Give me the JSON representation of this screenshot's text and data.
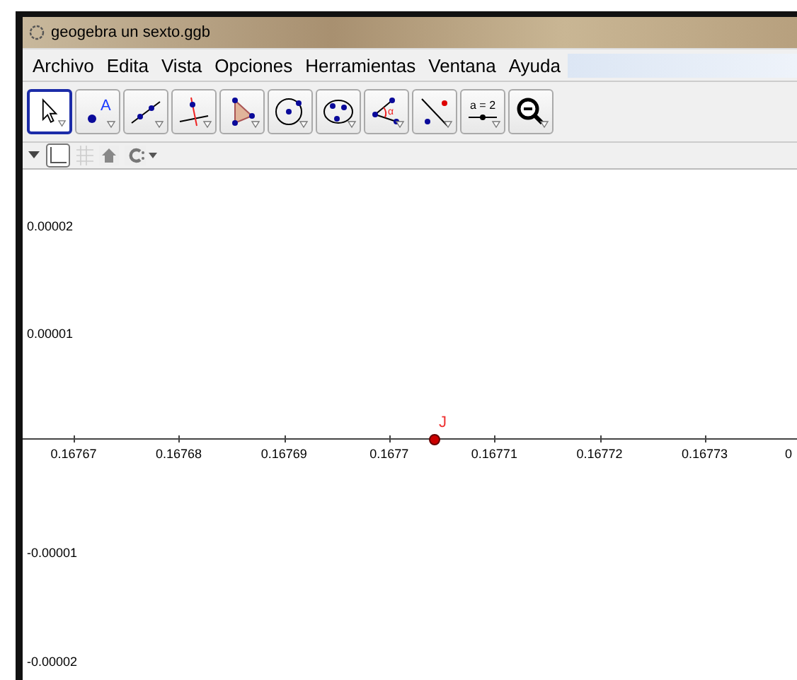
{
  "window": {
    "title": "geogebra un sexto.ggb"
  },
  "menu": [
    "Archivo",
    "Edita",
    "Vista",
    "Opciones",
    "Herramientas",
    "Ventana",
    "Ayuda"
  ],
  "tools": [
    {
      "kind": "move",
      "selected": true
    },
    {
      "kind": "point",
      "selected": false
    },
    {
      "kind": "line",
      "selected": false
    },
    {
      "kind": "perpendicular",
      "selected": false
    },
    {
      "kind": "polygon",
      "selected": false
    },
    {
      "kind": "circle",
      "selected": false
    },
    {
      "kind": "conic",
      "selected": false
    },
    {
      "kind": "angle",
      "selected": false
    },
    {
      "kind": "reflect",
      "selected": false
    },
    {
      "kind": "slider",
      "selected": false
    },
    {
      "kind": "zoom",
      "selected": false
    }
  ],
  "slider_label": "a = 2",
  "angle_label": "α",
  "point_tool_label": "A",
  "graph": {
    "y_labels": [
      "0.00002",
      "0.00001",
      "-0.00001",
      "-0.00002"
    ],
    "x_labels": [
      "0.16767",
      "0.16768",
      "0.16769",
      "0.1677",
      "0.16771",
      "0.16772",
      "0.16773",
      "0"
    ],
    "point": {
      "label": "J"
    }
  }
}
